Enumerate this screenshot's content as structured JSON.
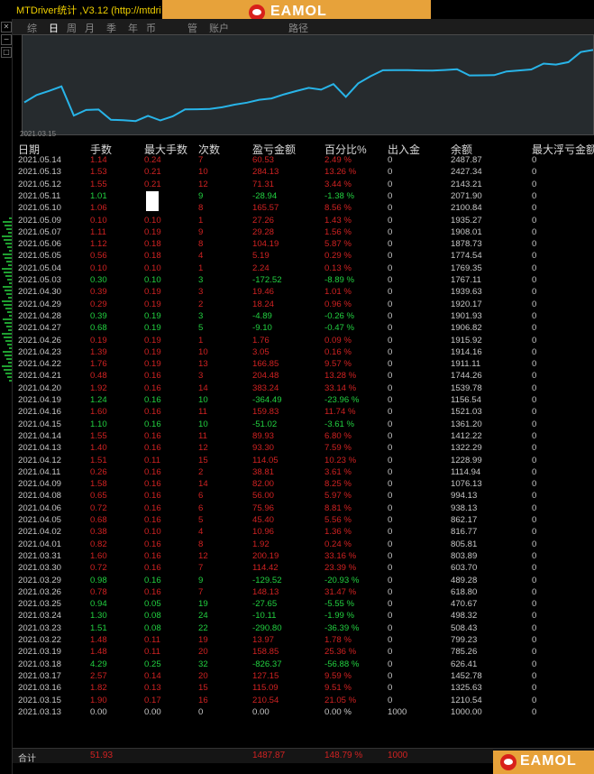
{
  "window": {
    "title": "MTDriver统计 ,V3.12 (http://mtdri",
    "banner_text": "EAMOL"
  },
  "periods": [
    "综",
    "日",
    "周",
    "月",
    "季",
    "年",
    "币",
    "",
    "管",
    "账户",
    "",
    "路径"
  ],
  "chart": {
    "start_label": "2021.03.15",
    "line_color": "#28b4e8",
    "balance_series": [
      1000.0,
      1210.54,
      1325.63,
      1452.78,
      626.41,
      785.26,
      799.23,
      508.43,
      498.32,
      470.67,
      618.8,
      489.28,
      603.7,
      803.89,
      805.81,
      816.77,
      862.17,
      938.13,
      994.13,
      1076.13,
      1114.94,
      1228.99,
      1322.29,
      1412.22,
      1361.2,
      1521.03,
      1156.54,
      1539.78,
      1744.26,
      1911.11,
      1914.16,
      1915.92,
      1906.82,
      1901.93,
      1920.17,
      1939.63,
      1767.11,
      1769.35,
      1774.54,
      1878.73,
      1908.01,
      1935.27,
      2100.84,
      2071.9,
      2143.21,
      2427.34,
      2487.87
    ]
  },
  "headers": [
    "日期",
    "手数",
    "最大手数",
    "次数",
    "盈亏金额",
    "百分比%",
    "出入金",
    "余额",
    "最大浮亏金额"
  ],
  "rows": [
    {
      "date": "2021.05.14",
      "lots": "1.14",
      "max_lots": "0.24",
      "count": "7",
      "pnl": "60.53",
      "pct": "2.49 %",
      "io": "0",
      "bal": "2487.87",
      "maxdd": "0",
      "pos": true
    },
    {
      "date": "2021.05.13",
      "lots": "1.53",
      "max_lots": "0.21",
      "count": "10",
      "pnl": "284.13",
      "pct": "13.26 %",
      "io": "0",
      "bal": "2427.34",
      "maxdd": "0",
      "pos": true
    },
    {
      "date": "2021.05.12",
      "lots": "1.55",
      "max_lots": "0.21",
      "count": "12",
      "pnl": "71.31",
      "pct": "3.44 %",
      "io": "0",
      "bal": "2143.21",
      "maxdd": "0",
      "pos": true
    },
    {
      "date": "2021.05.11",
      "lots": "1.01",
      "max_lots": "",
      "count": "9",
      "pnl": "-28.94",
      "pct": "-1.38 %",
      "io": "0",
      "bal": "2071.90",
      "maxdd": "0",
      "pos": false
    },
    {
      "date": "2021.05.10",
      "lots": "1.06",
      "max_lots": "",
      "count": "8",
      "pnl": "165.57",
      "pct": "8.56 %",
      "io": "0",
      "bal": "2100.84",
      "maxdd": "0",
      "pos": true
    },
    {
      "date": "2021.05.09",
      "lots": "0.10",
      "max_lots": "0.10",
      "count": "1",
      "pnl": "27.26",
      "pct": "1.43 %",
      "io": "0",
      "bal": "1935.27",
      "maxdd": "0",
      "pos": true
    },
    {
      "date": "2021.05.07",
      "lots": "1.11",
      "max_lots": "0.19",
      "count": "9",
      "pnl": "29.28",
      "pct": "1.56 %",
      "io": "0",
      "bal": "1908.01",
      "maxdd": "0",
      "pos": true
    },
    {
      "date": "2021.05.06",
      "lots": "1.12",
      "max_lots": "0.18",
      "count": "8",
      "pnl": "104.19",
      "pct": "5.87 %",
      "io": "0",
      "bal": "1878.73",
      "maxdd": "0",
      "pos": true
    },
    {
      "date": "2021.05.05",
      "lots": "0.56",
      "max_lots": "0.18",
      "count": "4",
      "pnl": "5.19",
      "pct": "0.29 %",
      "io": "0",
      "bal": "1774.54",
      "maxdd": "0",
      "pos": true
    },
    {
      "date": "2021.05.04",
      "lots": "0.10",
      "max_lots": "0.10",
      "count": "1",
      "pnl": "2.24",
      "pct": "0.13 %",
      "io": "0",
      "bal": "1769.35",
      "maxdd": "0",
      "pos": true
    },
    {
      "date": "2021.05.03",
      "lots": "0.30",
      "max_lots": "0.10",
      "count": "3",
      "pnl": "-172.52",
      "pct": "-8.89 %",
      "io": "0",
      "bal": "1767.11",
      "maxdd": "0",
      "pos": false
    },
    {
      "date": "2021.04.30",
      "lots": "0.39",
      "max_lots": "0.19",
      "count": "3",
      "pnl": "19.46",
      "pct": "1.01 %",
      "io": "0",
      "bal": "1939.63",
      "maxdd": "0",
      "pos": true
    },
    {
      "date": "2021.04.29",
      "lots": "0.29",
      "max_lots": "0.19",
      "count": "2",
      "pnl": "18.24",
      "pct": "0.96 %",
      "io": "0",
      "bal": "1920.17",
      "maxdd": "0",
      "pos": true
    },
    {
      "date": "2021.04.28",
      "lots": "0.39",
      "max_lots": "0.19",
      "count": "3",
      "pnl": "-4.89",
      "pct": "-0.26 %",
      "io": "0",
      "bal": "1901.93",
      "maxdd": "0",
      "pos": false
    },
    {
      "date": "2021.04.27",
      "lots": "0.68",
      "max_lots": "0.19",
      "count": "5",
      "pnl": "-9.10",
      "pct": "-0.47 %",
      "io": "0",
      "bal": "1906.82",
      "maxdd": "0",
      "pos": false
    },
    {
      "date": "2021.04.26",
      "lots": "0.19",
      "max_lots": "0.19",
      "count": "1",
      "pnl": "1.76",
      "pct": "0.09 %",
      "io": "0",
      "bal": "1915.92",
      "maxdd": "0",
      "pos": true
    },
    {
      "date": "2021.04.23",
      "lots": "1.39",
      "max_lots": "0.19",
      "count": "10",
      "pnl": "3.05",
      "pct": "0.16 %",
      "io": "0",
      "bal": "1914.16",
      "maxdd": "0",
      "pos": true
    },
    {
      "date": "2021.04.22",
      "lots": "1.76",
      "max_lots": "0.19",
      "count": "13",
      "pnl": "166.85",
      "pct": "9.57 %",
      "io": "0",
      "bal": "1911.11",
      "maxdd": "0",
      "pos": true
    },
    {
      "date": "2021.04.21",
      "lots": "0.48",
      "max_lots": "0.16",
      "count": "3",
      "pnl": "204.48",
      "pct": "13.28 %",
      "io": "0",
      "bal": "1744.26",
      "maxdd": "0",
      "pos": true
    },
    {
      "date": "2021.04.20",
      "lots": "1.92",
      "max_lots": "0.16",
      "count": "14",
      "pnl": "383.24",
      "pct": "33.14 %",
      "io": "0",
      "bal": "1539.78",
      "maxdd": "0",
      "pos": true
    },
    {
      "date": "2021.04.19",
      "lots": "1.24",
      "max_lots": "0.16",
      "count": "10",
      "pnl": "-364.49",
      "pct": "-23.96 %",
      "io": "0",
      "bal": "1156.54",
      "maxdd": "0",
      "pos": false
    },
    {
      "date": "2021.04.16",
      "lots": "1.60",
      "max_lots": "0.16",
      "count": "11",
      "pnl": "159.83",
      "pct": "11.74 %",
      "io": "0",
      "bal": "1521.03",
      "maxdd": "0",
      "pos": true
    },
    {
      "date": "2021.04.15",
      "lots": "1.10",
      "max_lots": "0.16",
      "count": "10",
      "pnl": "-51.02",
      "pct": "-3.61 %",
      "io": "0",
      "bal": "1361.20",
      "maxdd": "0",
      "pos": false
    },
    {
      "date": "2021.04.14",
      "lots": "1.55",
      "max_lots": "0.16",
      "count": "11",
      "pnl": "89.93",
      "pct": "6.80 %",
      "io": "0",
      "bal": "1412.22",
      "maxdd": "0",
      "pos": true
    },
    {
      "date": "2021.04.13",
      "lots": "1.40",
      "max_lots": "0.16",
      "count": "12",
      "pnl": "93.30",
      "pct": "7.59 %",
      "io": "0",
      "bal": "1322.29",
      "maxdd": "0",
      "pos": true
    },
    {
      "date": "2021.04.12",
      "lots": "1.51",
      "max_lots": "0.11",
      "count": "15",
      "pnl": "114.05",
      "pct": "10.23 %",
      "io": "0",
      "bal": "1228.99",
      "maxdd": "0",
      "pos": true
    },
    {
      "date": "2021.04.11",
      "lots": "0.26",
      "max_lots": "0.16",
      "count": "2",
      "pnl": "38.81",
      "pct": "3.61 %",
      "io": "0",
      "bal": "1114.94",
      "maxdd": "0",
      "pos": true
    },
    {
      "date": "2021.04.09",
      "lots": "1.58",
      "max_lots": "0.16",
      "count": "14",
      "pnl": "82.00",
      "pct": "8.25 %",
      "io": "0",
      "bal": "1076.13",
      "maxdd": "0",
      "pos": true
    },
    {
      "date": "2021.04.08",
      "lots": "0.65",
      "max_lots": "0.16",
      "count": "6",
      "pnl": "56.00",
      "pct": "5.97 %",
      "io": "0",
      "bal": "994.13",
      "maxdd": "0",
      "pos": true
    },
    {
      "date": "2021.04.06",
      "lots": "0.72",
      "max_lots": "0.16",
      "count": "6",
      "pnl": "75.96",
      "pct": "8.81 %",
      "io": "0",
      "bal": "938.13",
      "maxdd": "0",
      "pos": true
    },
    {
      "date": "2021.04.05",
      "lots": "0.68",
      "max_lots": "0.16",
      "count": "5",
      "pnl": "45.40",
      "pct": "5.56 %",
      "io": "0",
      "bal": "862.17",
      "maxdd": "0",
      "pos": true
    },
    {
      "date": "2021.04.02",
      "lots": "0.38",
      "max_lots": "0.10",
      "count": "4",
      "pnl": "10.96",
      "pct": "1.36 %",
      "io": "0",
      "bal": "816.77",
      "maxdd": "0",
      "pos": true
    },
    {
      "date": "2021.04.01",
      "lots": "0.82",
      "max_lots": "0.16",
      "count": "8",
      "pnl": "1.92",
      "pct": "0.24 %",
      "io": "0",
      "bal": "805.81",
      "maxdd": "0",
      "pos": true
    },
    {
      "date": "2021.03.31",
      "lots": "1.60",
      "max_lots": "0.16",
      "count": "12",
      "pnl": "200.19",
      "pct": "33.16 %",
      "io": "0",
      "bal": "803.89",
      "maxdd": "0",
      "pos": true
    },
    {
      "date": "2021.03.30",
      "lots": "0.72",
      "max_lots": "0.16",
      "count": "7",
      "pnl": "114.42",
      "pct": "23.39 %",
      "io": "0",
      "bal": "603.70",
      "maxdd": "0",
      "pos": true
    },
    {
      "date": "2021.03.29",
      "lots": "0.98",
      "max_lots": "0.16",
      "count": "9",
      "pnl": "-129.52",
      "pct": "-20.93 %",
      "io": "0",
      "bal": "489.28",
      "maxdd": "0",
      "pos": false
    },
    {
      "date": "2021.03.26",
      "lots": "0.78",
      "max_lots": "0.16",
      "count": "7",
      "pnl": "148.13",
      "pct": "31.47 %",
      "io": "0",
      "bal": "618.80",
      "maxdd": "0",
      "pos": true
    },
    {
      "date": "2021.03.25",
      "lots": "0.94",
      "max_lots": "0.05",
      "count": "19",
      "pnl": "-27.65",
      "pct": "-5.55 %",
      "io": "0",
      "bal": "470.67",
      "maxdd": "0",
      "pos": false
    },
    {
      "date": "2021.03.24",
      "lots": "1.30",
      "max_lots": "0.08",
      "count": "24",
      "pnl": "-10.11",
      "pct": "-1.99 %",
      "io": "0",
      "bal": "498.32",
      "maxdd": "0",
      "pos": false
    },
    {
      "date": "2021.03.23",
      "lots": "1.51",
      "max_lots": "0.08",
      "count": "22",
      "pnl": "-290.80",
      "pct": "-36.39 %",
      "io": "0",
      "bal": "508.43",
      "maxdd": "0",
      "pos": false
    },
    {
      "date": "2021.03.22",
      "lots": "1.48",
      "max_lots": "0.11",
      "count": "19",
      "pnl": "13.97",
      "pct": "1.78 %",
      "io": "0",
      "bal": "799.23",
      "maxdd": "0",
      "pos": true
    },
    {
      "date": "2021.03.19",
      "lots": "1.48",
      "max_lots": "0.11",
      "count": "20",
      "pnl": "158.85",
      "pct": "25.36 %",
      "io": "0",
      "bal": "785.26",
      "maxdd": "0",
      "pos": true
    },
    {
      "date": "2021.03.18",
      "lots": "4.29",
      "max_lots": "0.25",
      "count": "32",
      "pnl": "-826.37",
      "pct": "-56.88 %",
      "io": "0",
      "bal": "626.41",
      "maxdd": "0",
      "pos": false
    },
    {
      "date": "2021.03.17",
      "lots": "2.57",
      "max_lots": "0.14",
      "count": "20",
      "pnl": "127.15",
      "pct": "9.59 %",
      "io": "0",
      "bal": "1452.78",
      "maxdd": "0",
      "pos": true
    },
    {
      "date": "2021.03.16",
      "lots": "1.82",
      "max_lots": "0.13",
      "count": "15",
      "pnl": "115.09",
      "pct": "9.51 %",
      "io": "0",
      "bal": "1325.63",
      "maxdd": "0",
      "pos": true
    },
    {
      "date": "2021.03.15",
      "lots": "1.90",
      "max_lots": "0.17",
      "count": "16",
      "pnl": "210.54",
      "pct": "21.05 %",
      "io": "0",
      "bal": "1210.54",
      "maxdd": "0",
      "pos": true
    },
    {
      "date": "2021.03.13",
      "lots": "0.00",
      "max_lots": "0.00",
      "count": "0",
      "pnl": "0.00",
      "pct": "0.00 %",
      "io": "1000",
      "bal": "1000.00",
      "maxdd": "0",
      "pos": null
    }
  ],
  "total": {
    "label": "合计",
    "lots": "51.93",
    "pnl": "1487.87",
    "pct": "148.79 %",
    "io": "1000"
  },
  "watermark_text": "EAMOL",
  "colors": {
    "positive": "#d02222",
    "negative": "#22d040",
    "neutral": "#c8c8c8"
  }
}
